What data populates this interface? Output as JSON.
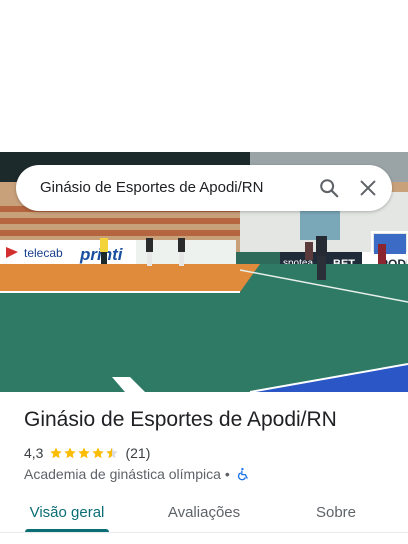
{
  "search": {
    "query": "Ginásio de Esportes de Apodi/RN",
    "search_icon": "search-icon",
    "close_icon": "close-icon"
  },
  "photo": {
    "banners": [
      "telecab",
      "printi",
      "spotea",
      "BET",
      "PODI"
    ]
  },
  "place": {
    "title": "Ginásio de Esportes de Apodi/RN",
    "rating": "4,3",
    "stars": 4.3,
    "reviews": "(21)",
    "category": "Academia de ginástica olímpica",
    "separator": "•",
    "accessibility_icon": "wheelchair-icon"
  },
  "tabs": [
    {
      "label": "Visão geral",
      "active": true
    },
    {
      "label": "Avaliações",
      "active": false
    },
    {
      "label": "Sobre",
      "active": false
    }
  ],
  "colors": {
    "accent": "#0b6e75",
    "star": "#fbbc04",
    "accessible": "#1a73e8"
  }
}
